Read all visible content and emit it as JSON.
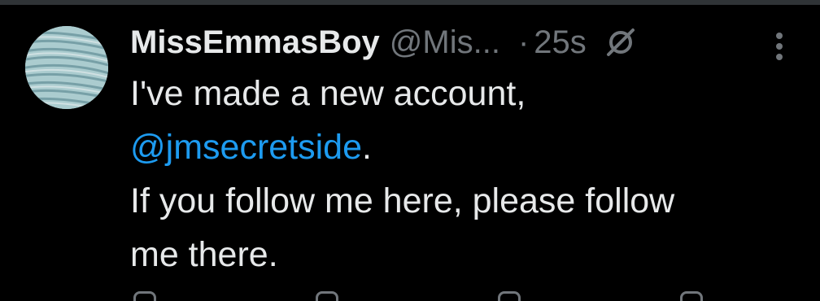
{
  "tweet": {
    "display_name": "MissEmmasBoy",
    "handle": "@Mis...",
    "separator": "·",
    "time": "25s",
    "text_line1": "I've made a new account,",
    "mention": "@jmsecretside",
    "mention_suffix": ".",
    "text_line3": "If you follow me here, please follow",
    "text_line4": "me there."
  },
  "icons": {
    "avatar": "avatar",
    "grok": "grok-icon",
    "more": "more-vertical-icon"
  },
  "colors": {
    "background": "#000000",
    "primary_text": "#e7e9ea",
    "secondary_text": "#71767b",
    "link": "#1d9bf0",
    "divider": "#2f3336"
  }
}
